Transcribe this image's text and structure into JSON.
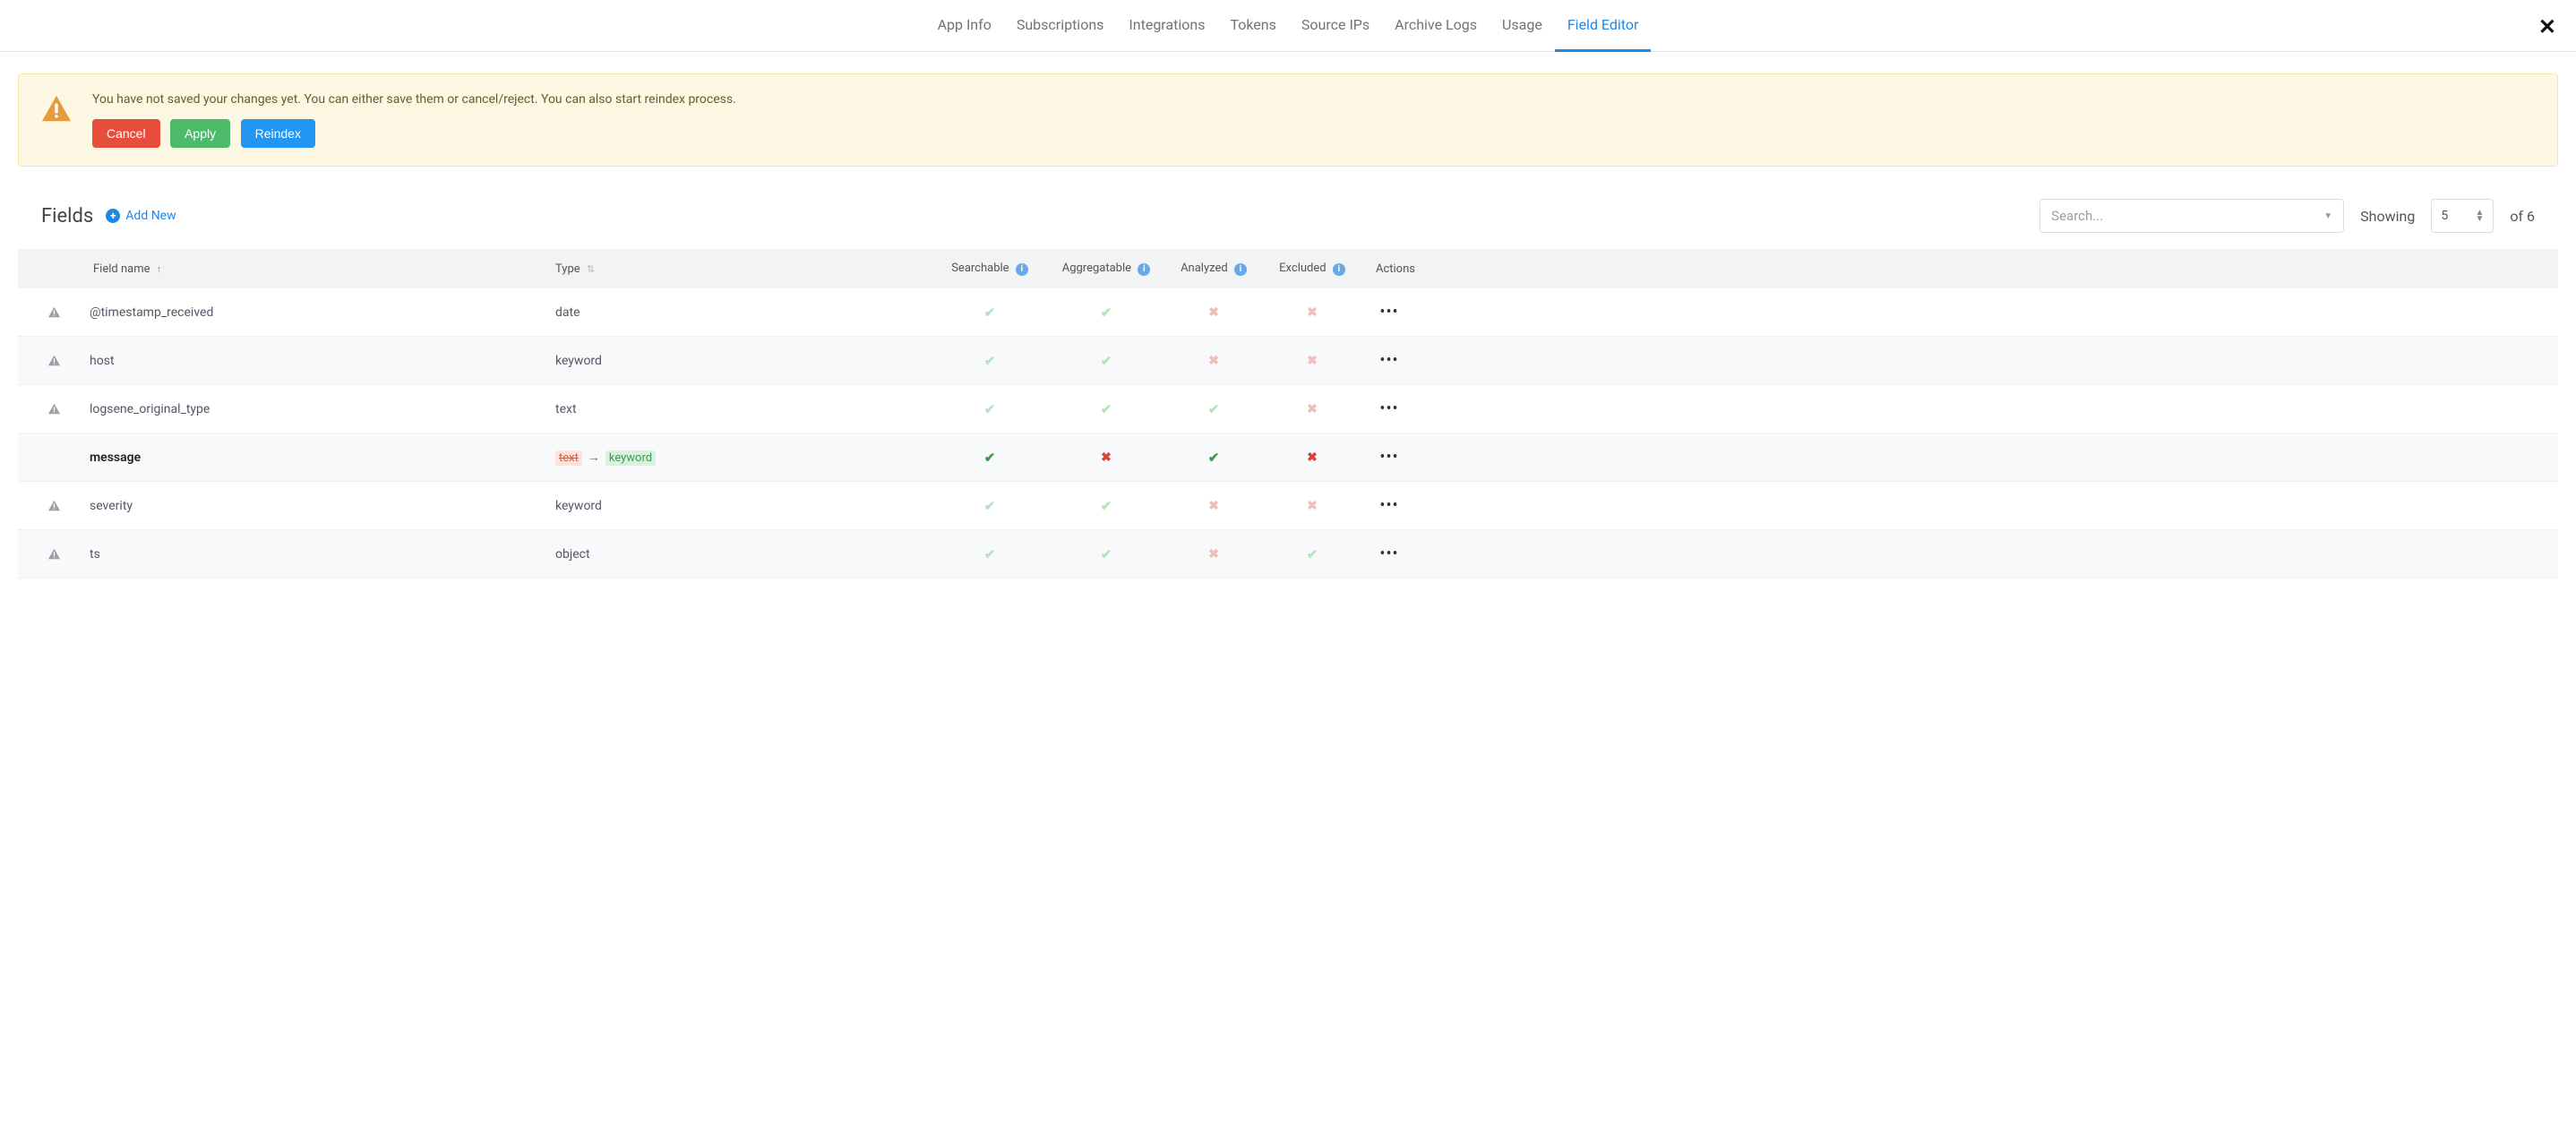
{
  "tabs": [
    "App Info",
    "Subscriptions",
    "Integrations",
    "Tokens",
    "Source IPs",
    "Archive Logs",
    "Usage",
    "Field Editor"
  ],
  "active_tab_index": 7,
  "alert": {
    "text": "You have not saved your changes yet. You can either save them or cancel/reject. You can also start reindex process.",
    "cancel": "Cancel",
    "apply": "Apply",
    "reindex": "Reindex"
  },
  "fields_section": {
    "title": "Fields",
    "add_new": "Add New",
    "search_placeholder": "Search...",
    "showing_label": "Showing",
    "page_size": "5",
    "of_label": "of 6"
  },
  "columns": {
    "name": "Field name",
    "type": "Type",
    "searchable": "Searchable",
    "aggregatable": "Aggregatable",
    "analyzed": "Analyzed",
    "excluded": "Excluded",
    "actions": "Actions"
  },
  "rows": [
    {
      "warn": true,
      "name": "@timestamp_received",
      "bold": false,
      "type": "date",
      "type_changed": false,
      "searchable": "check-light",
      "aggregatable": "check-light",
      "analyzed": "x-light",
      "excluded": "x-light",
      "stripe": false
    },
    {
      "warn": true,
      "name": "host",
      "bold": false,
      "type": "keyword",
      "type_changed": false,
      "searchable": "check-light",
      "aggregatable": "check-light",
      "analyzed": "x-light",
      "excluded": "x-light",
      "stripe": true
    },
    {
      "warn": true,
      "name": "logsene_original_type",
      "bold": false,
      "type": "text",
      "type_changed": false,
      "searchable": "check-light",
      "aggregatable": "check-light",
      "analyzed": "check-light",
      "excluded": "x-light",
      "stripe": false
    },
    {
      "warn": false,
      "name": "message",
      "bold": true,
      "type_changed": true,
      "type_from": "text",
      "type_to": "keyword",
      "searchable": "check-dark",
      "aggregatable": "x-dark",
      "analyzed": "check-dark",
      "excluded": "x-dark",
      "stripe": true
    },
    {
      "warn": true,
      "name": "severity",
      "bold": false,
      "type": "keyword",
      "type_changed": false,
      "searchable": "check-light",
      "aggregatable": "check-light",
      "analyzed": "x-light",
      "excluded": "x-light",
      "stripe": false
    },
    {
      "warn": true,
      "name": "ts",
      "bold": false,
      "type": "object",
      "type_changed": false,
      "searchable": "check-light",
      "aggregatable": "check-light",
      "analyzed": "x-light",
      "excluded": "check-light",
      "stripe": true
    }
  ]
}
